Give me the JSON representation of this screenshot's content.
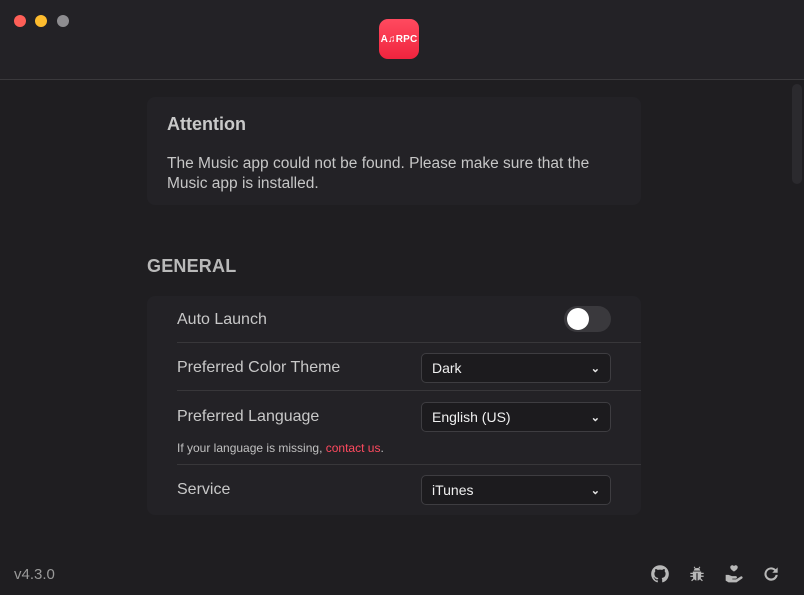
{
  "app": {
    "logo_text": "A♫RPC"
  },
  "attention": {
    "title": "Attention",
    "message": "The Music app could not be found. Please make sure that the Music app is installed."
  },
  "general": {
    "section_title": "GENERAL",
    "auto_launch": {
      "label": "Auto Launch",
      "enabled": false
    },
    "color_theme": {
      "label": "Preferred Color Theme",
      "value": "Dark"
    },
    "language": {
      "label": "Preferred Language",
      "value": "English (US)",
      "hint_prefix": "If your language is missing, ",
      "hint_link": "contact us",
      "hint_suffix": "."
    },
    "service": {
      "label": "Service",
      "value": "iTunes"
    }
  },
  "footer": {
    "version": "v4.3.0",
    "icons": [
      "github-icon",
      "bug-icon",
      "donate-icon",
      "reload-icon"
    ]
  },
  "colors": {
    "accent": "#ff4a5f",
    "background": "#1f1e21",
    "card": "#232226"
  }
}
